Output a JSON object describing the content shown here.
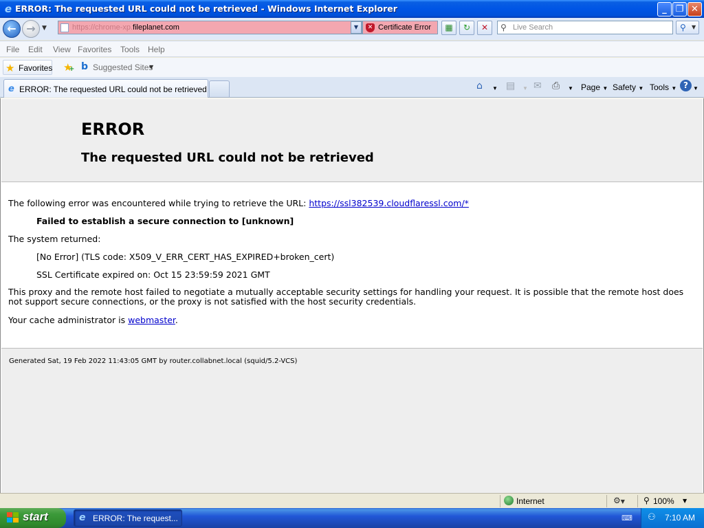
{
  "window": {
    "title": "ERROR: The requested URL could not be retrieved - Windows Internet Explorer",
    "minimize_label": "_",
    "maximize_label": "❐",
    "close_label": "✕"
  },
  "address_bar": {
    "url_protocol": "https://chrome-xp.",
    "url_host": "fileplanet.com",
    "certificate_error_label": "Certificate Error"
  },
  "search": {
    "placeholder": "Live Search"
  },
  "menu": {
    "items": [
      "File",
      "Edit",
      "View",
      "Favorites",
      "Tools",
      "Help"
    ]
  },
  "favorites_bar": {
    "favorites_label": "Favorites",
    "suggested_sites_label": "Suggested Sites"
  },
  "tabs": {
    "active_tab_title": "ERROR: The requested URL could not be retrieved"
  },
  "command_bar": {
    "page_label": "Page",
    "safety_label": "Safety",
    "tools_label": "Tools"
  },
  "page": {
    "heading": "ERROR",
    "subheading": "The requested URL could not be retrieved",
    "intro_text": "The following error was encountered while trying to retrieve the URL: ",
    "intro_link": "https://ssl382539.cloudflaressl.com/*",
    "failure_text": "Failed to establish a secure connection to [unknown]",
    "system_returned_label": "The system returned:",
    "tls_code_text": "[No Error] (TLS code: X509_V_ERR_CERT_HAS_EXPIRED+broken_cert)",
    "ssl_expired_text": "SSL Certificate expired on: Oct 15 23:59:59 2021 GMT",
    "proxy_explanation": "This proxy and the remote host failed to negotiate a mutually acceptable security settings for handling your request. It is possible that the remote host does not support secure connections, or the proxy is not satisfied with the host security credentials.",
    "admin_text": "Your cache administrator is ",
    "admin_link": "webmaster",
    "admin_suffix": ".",
    "footer": "Generated Sat, 19 Feb 2022 11:43:05 GMT by router.collabnet.local (squid/5.2-VCS)"
  },
  "status_bar": {
    "zone_label": "Internet",
    "zoom_label": "100%"
  },
  "taskbar": {
    "start_label": "start",
    "task_item_label": "ERROR: The request...",
    "clock": "7:10 AM"
  },
  "colors": {
    "address_error_bg": "#f3a7b0",
    "link": "#0000cc",
    "titlebar": "#0055e5",
    "start_button": "#3c9a3a"
  }
}
